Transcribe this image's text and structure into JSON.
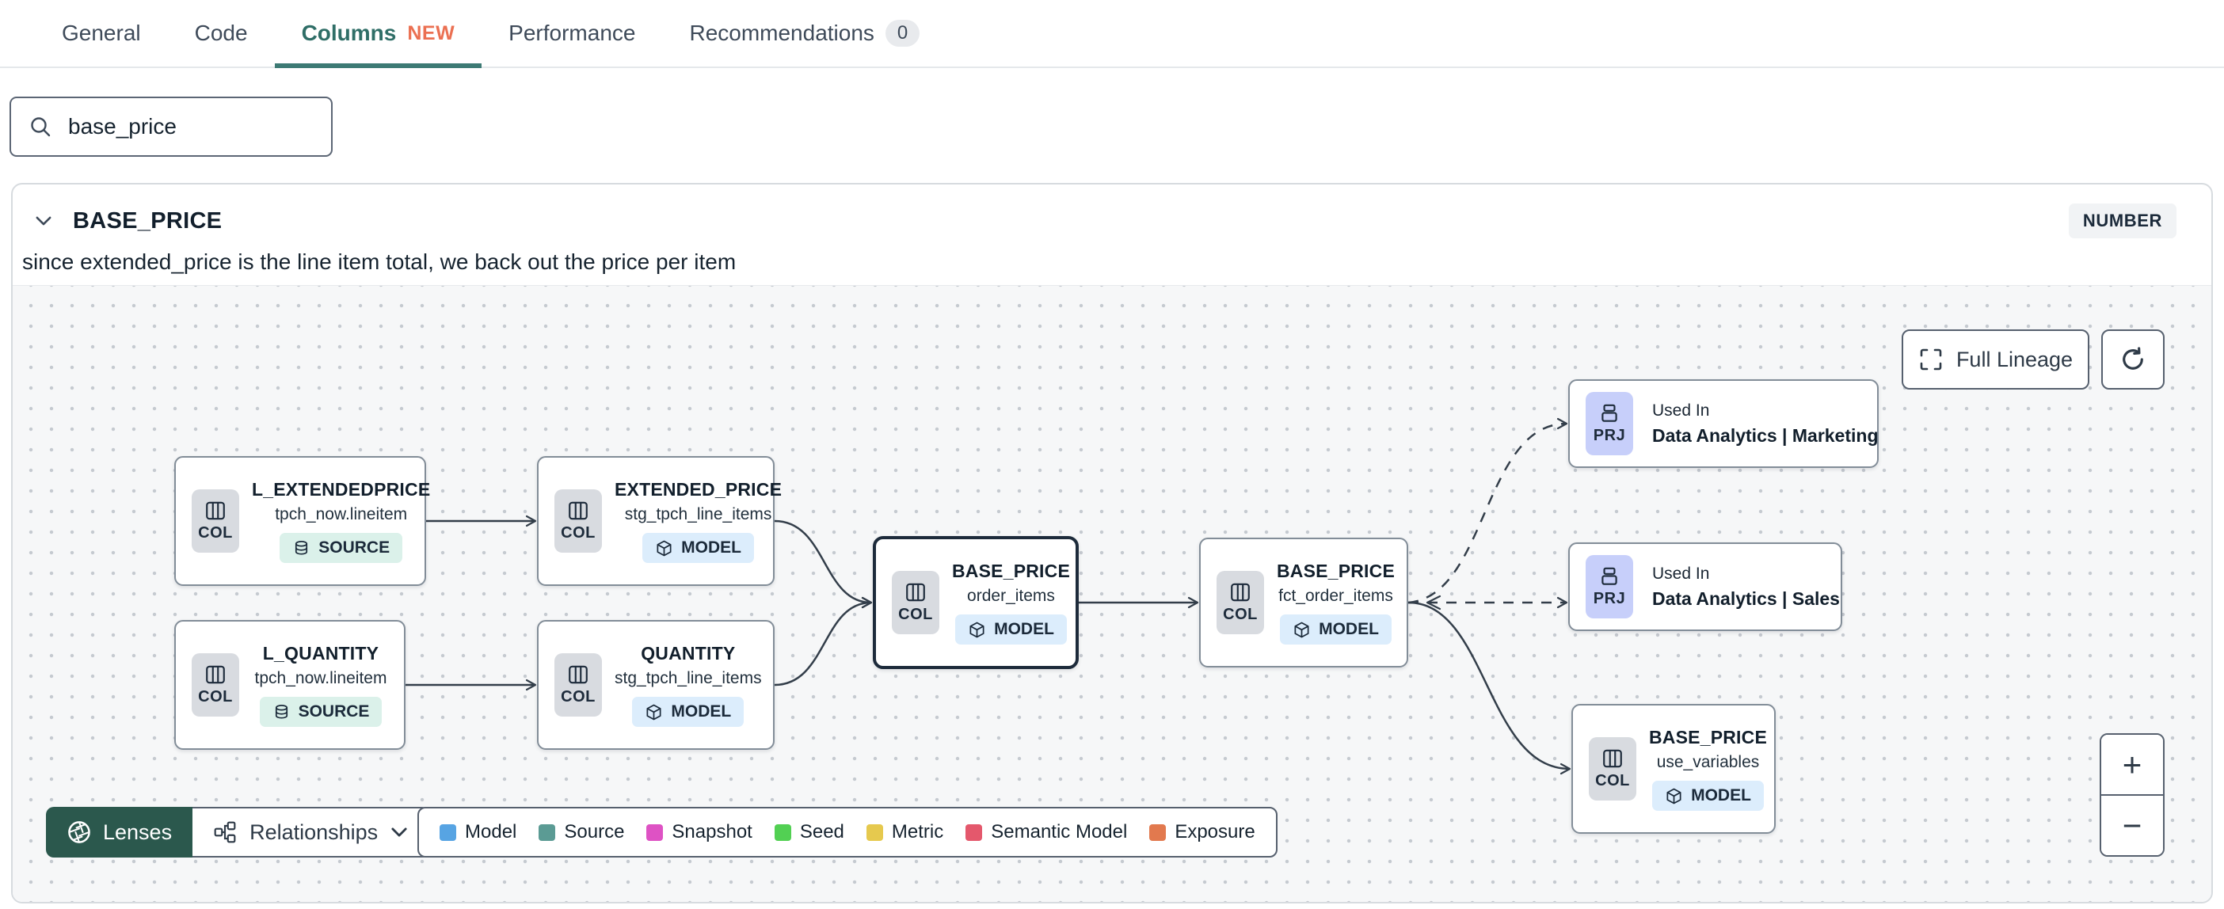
{
  "tabs": {
    "items": [
      {
        "label": "General"
      },
      {
        "label": "Code"
      },
      {
        "label": "Columns",
        "badge": "NEW",
        "active": true
      },
      {
        "label": "Performance"
      },
      {
        "label": "Recommendations",
        "count": "0"
      }
    ]
  },
  "search": {
    "value": "base_price"
  },
  "column_panel": {
    "name": "BASE_PRICE",
    "type_badge": "NUMBER",
    "description": "since extended_price is the line item total, we back out the price per item"
  },
  "lineage": {
    "controls": {
      "full_lineage_label": "Full Lineage",
      "lenses_label": "Lenses",
      "relationships_label": "Relationships",
      "zoom_in": "+",
      "zoom_out": "−"
    },
    "legend": {
      "items": [
        {
          "label": "Model",
          "color": "#57A4E3"
        },
        {
          "label": "Source",
          "color": "#5B9B94"
        },
        {
          "label": "Snapshot",
          "color": "#DE52C4"
        },
        {
          "label": "Seed",
          "color": "#52D053"
        },
        {
          "label": "Metric",
          "color": "#E6C94E"
        },
        {
          "label": "Semantic Model",
          "color": "#E4586C"
        },
        {
          "label": "Exposure",
          "color": "#E2794E"
        }
      ]
    },
    "colors": {
      "accent_teal": "#2F6E67",
      "new_orange": "#EB7052",
      "lenses_green": "#2B584D",
      "model_badge_bg": "#DCEDFC",
      "source_badge_bg": "#DBF1EA",
      "project_badge_bg": "#C7CFFA",
      "selected_border": "#1D2B3B"
    },
    "nodes": [
      {
        "title": "L_EXTENDEDPRICE",
        "subtitle": "tpch_now.lineitem",
        "resource_badge": "SOURCE",
        "type_badge": "COL"
      },
      {
        "title": "EXTENDED_PRICE",
        "subtitle": "stg_tpch_line_items",
        "resource_badge": "MODEL",
        "type_badge": "COL"
      },
      {
        "title": "L_QUANTITY",
        "subtitle": "tpch_now.lineitem",
        "resource_badge": "SOURCE",
        "type_badge": "COL"
      },
      {
        "title": "QUANTITY",
        "subtitle": "stg_tpch_line_items",
        "resource_badge": "MODEL",
        "type_badge": "COL"
      },
      {
        "title": "BASE_PRICE",
        "subtitle": "order_items",
        "resource_badge": "MODEL",
        "type_badge": "COL",
        "selected": true
      },
      {
        "title": "BASE_PRICE",
        "subtitle": "fct_order_items",
        "resource_badge": "MODEL",
        "type_badge": "COL"
      },
      {
        "label": "Used In",
        "title": "Data Analytics | Marketing",
        "type_badge": "PRJ"
      },
      {
        "label": "Used In",
        "title": "Data Analytics | Sales",
        "type_badge": "PRJ"
      },
      {
        "title": "BASE_PRICE",
        "subtitle": "use_variables",
        "resource_badge": "MODEL",
        "type_badge": "COL"
      }
    ]
  }
}
